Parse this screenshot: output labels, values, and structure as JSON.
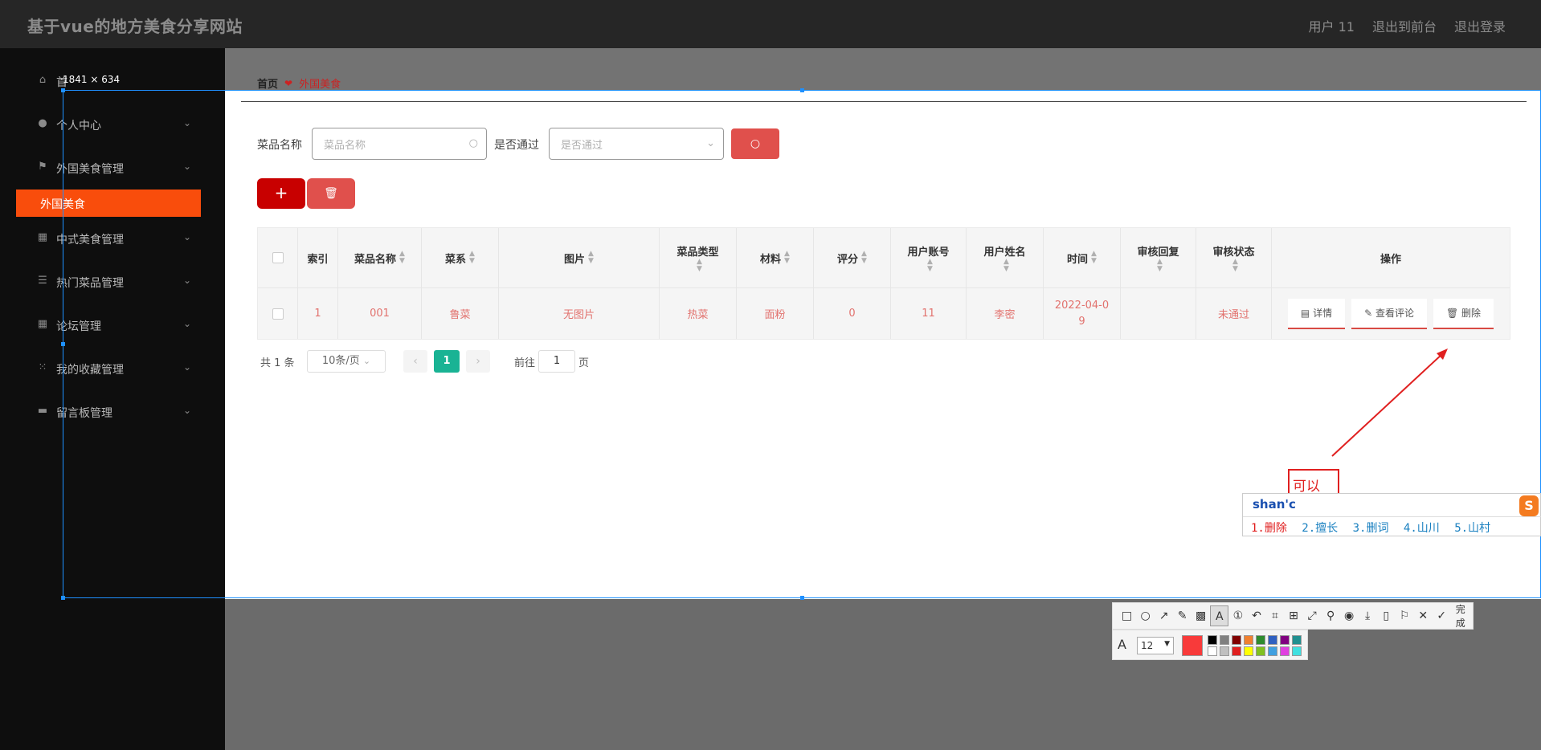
{
  "header": {
    "title": "基于vue的地方美食分享网站",
    "user": "用户 11",
    "to_front": "退出到前台",
    "logout": "退出登录"
  },
  "sidebar": {
    "items": [
      {
        "label": "首",
        "icon": "home-icon"
      },
      {
        "label": "个人中心",
        "icon": "user-icon"
      },
      {
        "label": "外国美食管理",
        "icon": "flag-icon"
      },
      {
        "label": "中式美食管理",
        "icon": "grid-icon"
      },
      {
        "label": "热门菜品管理",
        "icon": "list-icon"
      },
      {
        "label": "论坛管理",
        "icon": "grid-icon"
      },
      {
        "label": "我的收藏管理",
        "icon": "apps-icon"
      },
      {
        "label": "留言板管理",
        "icon": "message-icon"
      }
    ],
    "active_sub": "外国美食"
  },
  "breadcrumb": {
    "home": "首页",
    "current": "外国美食"
  },
  "search": {
    "name_label": "菜品名称",
    "name_placeholder": "菜品名称",
    "pass_label": "是否通过",
    "pass_placeholder": "是否通过"
  },
  "table": {
    "headers": [
      "索引",
      "菜品名称",
      "菜系",
      "图片",
      "菜品类型",
      "材料",
      "评分",
      "用户账号",
      "用户姓名",
      "时间",
      "审核回复",
      "审核状态",
      "操作"
    ],
    "row": {
      "index": "1",
      "name": "001",
      "cuisine": "鲁菜",
      "image": "无图片",
      "type": "热菜",
      "material": "面粉",
      "score": "0",
      "account": "11",
      "username": "李密",
      "time": "2022-04-09",
      "reply": "",
      "status": "未通过"
    },
    "actions": {
      "detail": "详情",
      "comments": "查看评论",
      "delete": "删除"
    }
  },
  "pagination": {
    "total": "共 1 条",
    "page_size": "10条/页",
    "current": "1",
    "goto_label": "前往",
    "goto_value": "1",
    "page_unit": "页"
  },
  "screenshot_tool": {
    "selection_size": "1841 × 634",
    "annotation_text": "可以",
    "font_size": "12",
    "done_label": "完成",
    "current_color": "#f83a3a",
    "palette": [
      "#000000",
      "#808080",
      "#800000",
      "#f08030",
      "#2e8b2e",
      "#3060c0",
      "#800080",
      "#209090",
      "#ffffff",
      "#c0c0c0",
      "#e02020",
      "#ffff00",
      "#80c020",
      "#40a0e0",
      "#e040e0",
      "#40e0e0"
    ]
  },
  "ime": {
    "input": "shan'c",
    "candidates": [
      "1.删除",
      "2.擅长",
      "3.删词",
      "4.山川",
      "5.山村"
    ],
    "logo": "S"
  }
}
